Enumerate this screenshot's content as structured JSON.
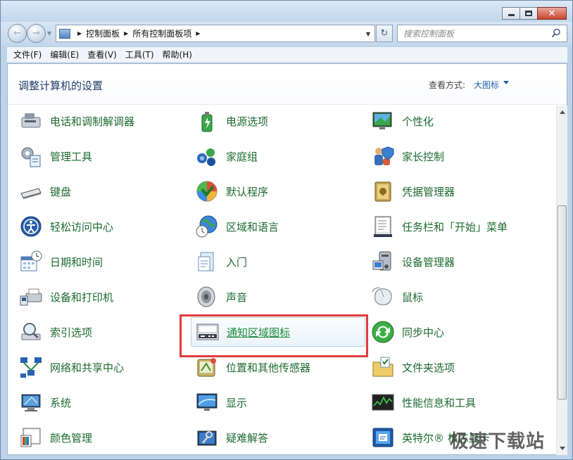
{
  "window": {
    "caption_buttons": [
      "minimize-icon",
      "maximize-icon",
      "close-icon"
    ],
    "close_glyph": "✕"
  },
  "address_bar": {
    "back_glyph": "←",
    "forward_glyph": "→",
    "breadcrumbs": [
      "控制面板",
      "所有控制面板项"
    ],
    "refresh_glyph": "↻",
    "search_placeholder": "搜索控制面板"
  },
  "menubar": {
    "items": [
      "文件(F)",
      "编辑(E)",
      "查看(V)",
      "工具(T)",
      "帮助(H)"
    ]
  },
  "header": {
    "title": "调整计算机的设置",
    "view_by_label": "查看方式:",
    "view_by_value": "大图标"
  },
  "items": {
    "col1": [
      "电话和调制解调器",
      "管理工具",
      "键盘",
      "轻松访问中心",
      "日期和时间",
      "设备和打印机",
      "索引选项",
      "网络和共享中心",
      "系统",
      "颜色管理"
    ],
    "col2": [
      "电源选项",
      "家庭组",
      "默认程序",
      "区域和语言",
      "入门",
      "声音",
      "通知区域图标",
      "位置和其他传感器",
      "显示",
      "疑难解答"
    ],
    "col3": [
      "个性化",
      "家长控制",
      "凭据管理器",
      "任务栏和「开始」菜单",
      "设备管理器",
      "鼠标",
      "同步中心",
      "文件夹选项",
      "性能信息和工具",
      "英特尔® 核芯显卡"
    ]
  },
  "highlighted_item": "通知区域图标",
  "colors": {
    "link_green": "#1c6b2f",
    "highlight_red": "#e03c3c",
    "title_blue": "#1f3d68"
  },
  "watermark": "极速下载站"
}
